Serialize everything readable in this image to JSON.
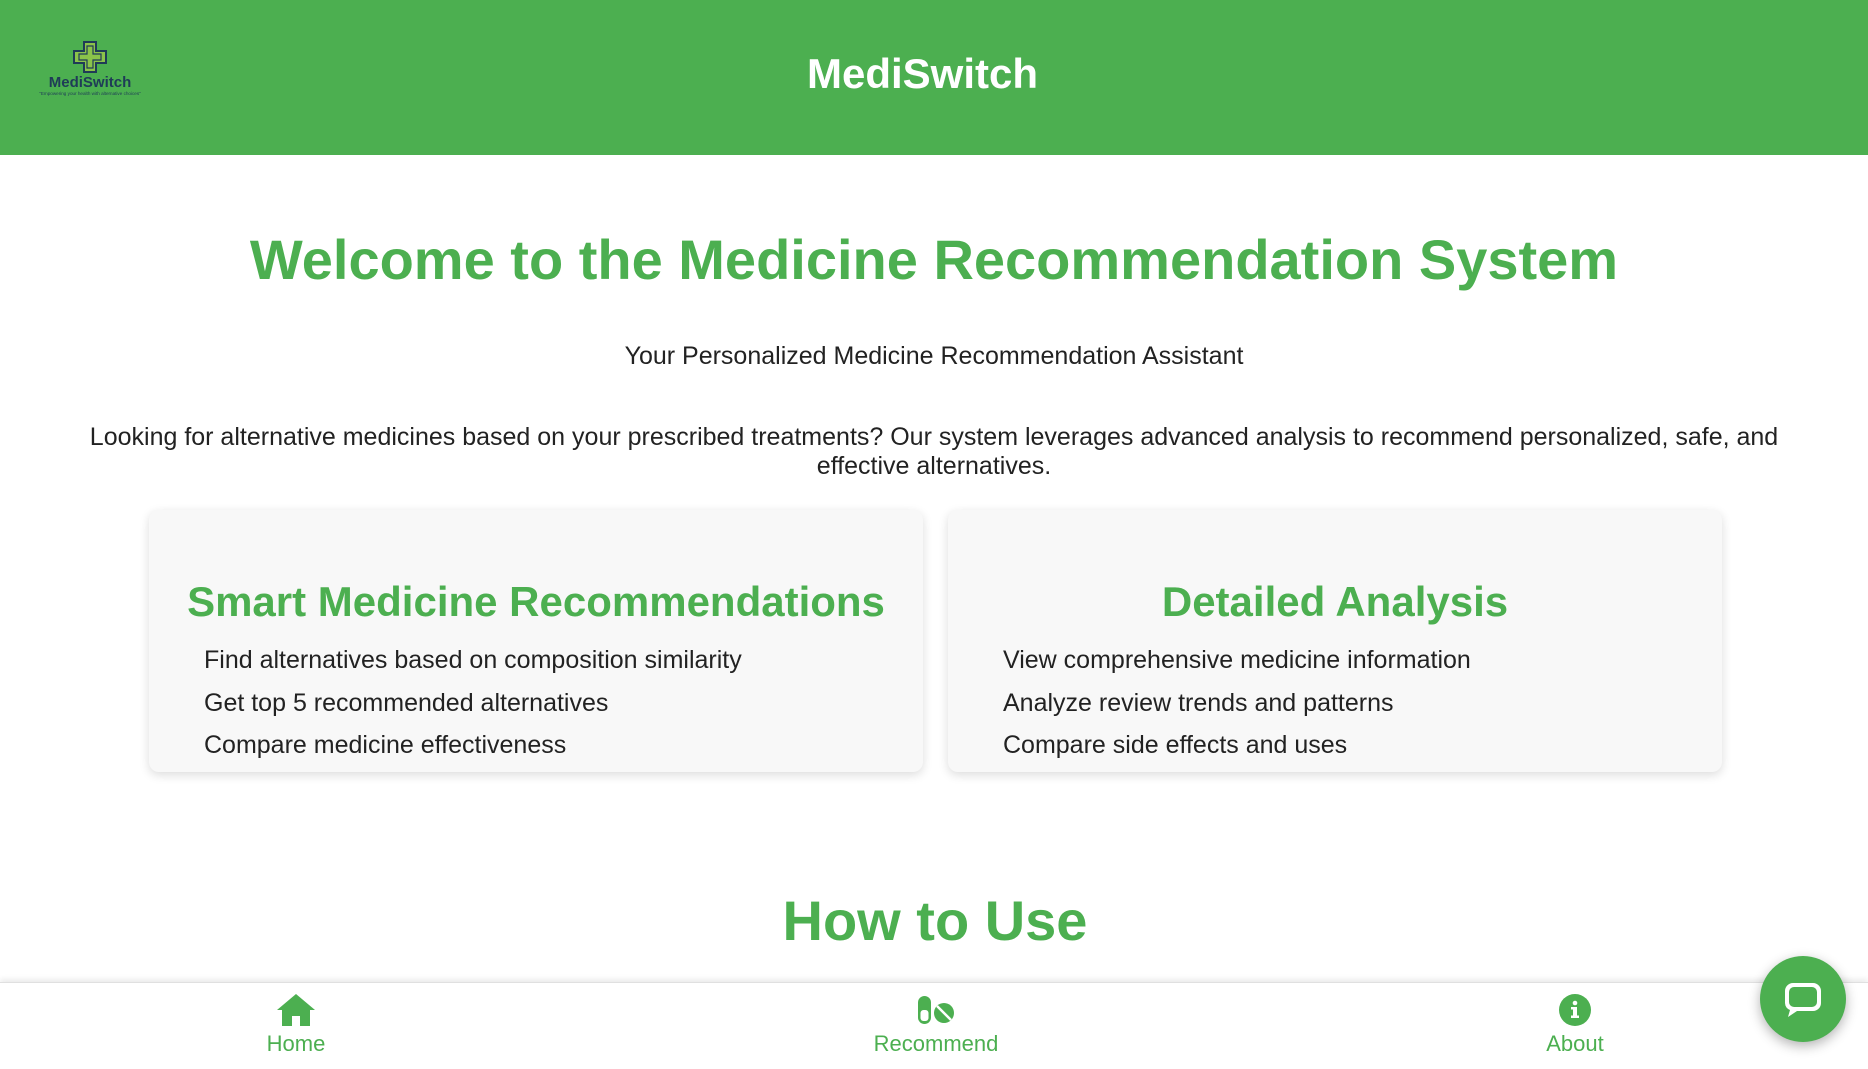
{
  "header": {
    "logo": {
      "name": "MediSwitch",
      "tagline": "\"Empowering your health with alternative choices\""
    },
    "title": "MediSwitch"
  },
  "main": {
    "welcome_heading": "Welcome to the Medicine Recommendation System",
    "subtitle": "Your Personalized Medicine Recommendation Assistant",
    "intro": "Looking for alternative medicines based on your prescribed treatments? Our system leverages advanced analysis to recommend personalized, safe, and effective alternatives.",
    "cards": [
      {
        "title": "Smart Medicine Recommendations",
        "items": [
          "Find alternatives based on composition similarity",
          "Get top 5 recommended alternatives",
          "Compare medicine effectiveness"
        ]
      },
      {
        "title": "Detailed Analysis",
        "items": [
          "View comprehensive medicine information",
          "Analyze review trends and patterns",
          "Compare side effects and uses"
        ]
      }
    ],
    "how_to_heading": "How to Use"
  },
  "bottom_nav": {
    "items": [
      {
        "label": "Home",
        "icon": "home-icon"
      },
      {
        "label": "Recommend",
        "icon": "pills-icon"
      },
      {
        "label": "About",
        "icon": "info-circle-icon"
      }
    ]
  },
  "chat_button": {
    "icon": "chat-bubble-icon"
  },
  "colors": {
    "brand_green": "#4caf50",
    "card_background": "#f8f8f8",
    "text": "#222222",
    "logo_text": "#1f3b57"
  }
}
